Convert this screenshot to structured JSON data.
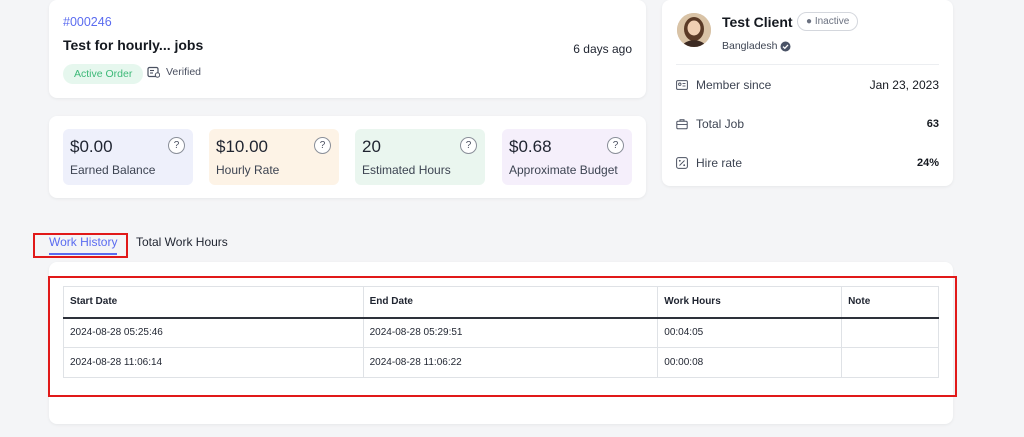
{
  "order": {
    "id": "#000246",
    "title": "Test for hourly... jobs",
    "time_ago": "6 days ago",
    "status_badge": "Active Order",
    "verified_label": "Verified"
  },
  "stats": [
    {
      "value": "$0.00",
      "label": "Earned Balance",
      "bg": "#eef0fb"
    },
    {
      "value": "$10.00",
      "label": "Hourly Rate",
      "bg": "#fdf3e6"
    },
    {
      "value": "20",
      "label": "Estimated Hours",
      "bg": "#eaf6ef"
    },
    {
      "value": "$0.68",
      "label": "Approximate Budget",
      "bg": "#f5effb"
    }
  ],
  "stat_help_glyph": "?",
  "client": {
    "name": "Test Client",
    "status": "Inactive",
    "country": "Bangladesh",
    "rows": [
      {
        "label": "Member since",
        "value": "Jan 23, 2023",
        "icon": "id-card-icon"
      },
      {
        "label": "Total Job",
        "value": "63",
        "icon": "briefcase-icon"
      },
      {
        "label": "Hire rate",
        "value": "24%",
        "icon": "percent-icon"
      }
    ]
  },
  "tabs": [
    {
      "label": "Work History",
      "active": true
    },
    {
      "label": "Total Work Hours",
      "active": false
    }
  ],
  "work_table": {
    "headers": [
      "Start Date",
      "End Date",
      "Work Hours",
      "Note"
    ],
    "rows": [
      [
        "2024-08-28 05:25:46",
        "2024-08-28 05:29:51",
        "00:04:05",
        ""
      ],
      [
        "2024-08-28 11:06:14",
        "2024-08-28 11:06:22",
        "00:00:08",
        ""
      ]
    ]
  },
  "colors": {
    "accent": "#5b6cf0",
    "active_green": "#3db978",
    "highlight_red": "#e11919"
  }
}
